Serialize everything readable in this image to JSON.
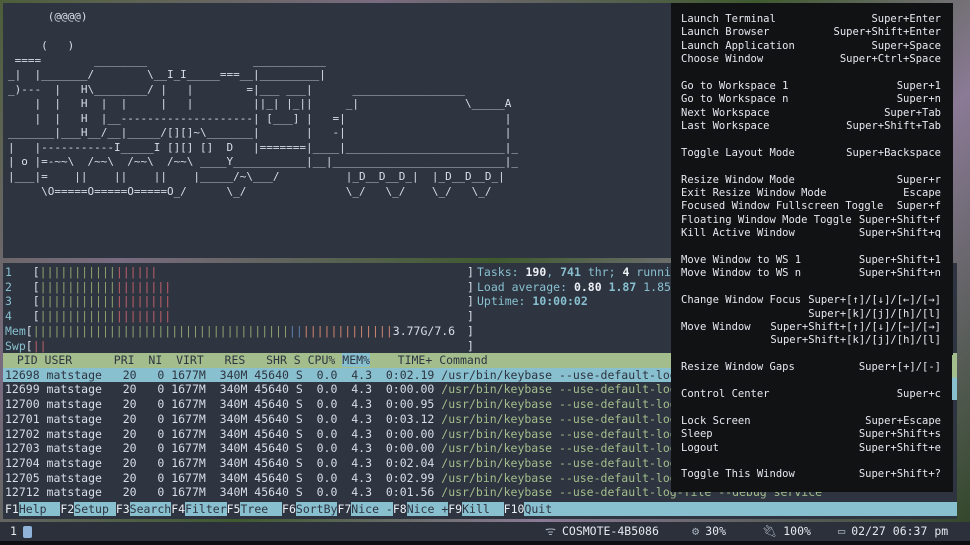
{
  "ascii_window": {
    "lines": [
      "      (@@@@)",
      "",
      "     (   )",
      " ====        ________                ___________",
      "_|  |_______/        \\__I_I_____===__|_________|",
      "_)---  |   H\\________/ |   |        =|___ ___|      _________________",
      "    |  |   H  |  |     |   |         ||_| |_||     _|                \\_____A",
      "    |  |   H  |__--------------------| [___] |   =|                        |",
      "_______|___H__/__|_____/[][]~\\_______|       |   -|                        |",
      "|   |-----------I_____I [][] []  D   |=======|____|________________________|_",
      "| o |=-~~\\  /~~\\  /~~\\  /~~\\ ____Y___________|__|__________________________|_",
      "|___|=    ||    ||    ||    |_____/~\\___/          |_D__D__D_|  |_D__D__D_|",
      "     \\O=====O=====O=====O_/      \\_/               \\_/   \\_/    \\_/   \\_/"
    ]
  },
  "htop": {
    "meters": [
      {
        "label": "1   ",
        "normal_pct": 17.7,
        "kernel_pct": 9.7
      },
      {
        "label": "2   ",
        "normal_pct": 17.7,
        "kernel_pct": 12.9
      },
      {
        "label": "3   ",
        "normal_pct": 17.7,
        "kernel_pct": 12.9
      },
      {
        "label": "4   ",
        "normal_pct": 17.7,
        "kernel_pct": 12.9
      }
    ],
    "mem": {
      "label": "Mem",
      "used_pct": 59.7,
      "buffers_pct": 3.2,
      "cache_pct": 21.0,
      "text": "3.77G/7.6"
    },
    "swp": {
      "label": "Swp",
      "used_pct": 3.2
    },
    "tasks": {
      "label": "Tasks: ",
      "count": "190",
      "sep1": ", ",
      "threads": "741",
      "thr_label": " thr; ",
      "running": "4",
      "running_label": " running"
    },
    "load": {
      "label": "Load average: ",
      "v1": "0.80",
      "v5": "1.87",
      "v15": "1.85"
    },
    "uptime": {
      "label": "Uptime: ",
      "value": "10:00:02"
    },
    "header": {
      "pre": "  PID USER      PRI  NI  VIRT   RES   SHR S CPU% ",
      "sorted": "MEM%",
      "post": "    TIME+ Command"
    },
    "processes": [
      {
        "pid": "12698",
        "user": "matstage",
        "pri": "20",
        "ni": "0",
        "virt": "1677M",
        "res": "340M",
        "shr": "45640",
        "s": "S",
        "cpu": "0.0",
        "mem": "4.3",
        "time": "0:02.19",
        "cmd": "/usr/bin/keybase --use-default-log-file --debug service"
      },
      {
        "pid": "12699",
        "user": "matstage",
        "pri": "20",
        "ni": "0",
        "virt": "1677M",
        "res": "340M",
        "shr": "45640",
        "s": "S",
        "cpu": "0.0",
        "mem": "4.3",
        "time": "0:00.00",
        "cmd": "/usr/bin/keybase --use-default-log-file --debug service"
      },
      {
        "pid": "12700",
        "user": "matstage",
        "pri": "20",
        "ni": "0",
        "virt": "1677M",
        "res": "340M",
        "shr": "45640",
        "s": "S",
        "cpu": "0.0",
        "mem": "4.3",
        "time": "0:00.95",
        "cmd": "/usr/bin/keybase --use-default-log-file --debug service"
      },
      {
        "pid": "12701",
        "user": "matstage",
        "pri": "20",
        "ni": "0",
        "virt": "1677M",
        "res": "340M",
        "shr": "45640",
        "s": "S",
        "cpu": "0.0",
        "mem": "4.3",
        "time": "0:03.12",
        "cmd": "/usr/bin/keybase --use-default-log-file --debug service"
      },
      {
        "pid": "12702",
        "user": "matstage",
        "pri": "20",
        "ni": "0",
        "virt": "1677M",
        "res": "340M",
        "shr": "45640",
        "s": "S",
        "cpu": "0.0",
        "mem": "4.3",
        "time": "0:00.00",
        "cmd": "/usr/bin/keybase --use-default-log-file --debug service"
      },
      {
        "pid": "12703",
        "user": "matstage",
        "pri": "20",
        "ni": "0",
        "virt": "1677M",
        "res": "340M",
        "shr": "45640",
        "s": "S",
        "cpu": "0.0",
        "mem": "4.3",
        "time": "0:00.00",
        "cmd": "/usr/bin/keybase --use-default-log-file --debug service"
      },
      {
        "pid": "12704",
        "user": "matstage",
        "pri": "20",
        "ni": "0",
        "virt": "1677M",
        "res": "340M",
        "shr": "45640",
        "s": "S",
        "cpu": "0.0",
        "mem": "4.3",
        "time": "0:02.04",
        "cmd": "/usr/bin/keybase --use-default-log-file --debug service"
      },
      {
        "pid": "12705",
        "user": "matstage",
        "pri": "20",
        "ni": "0",
        "virt": "1677M",
        "res": "340M",
        "shr": "45640",
        "s": "S",
        "cpu": "0.0",
        "mem": "4.3",
        "time": "0:02.99",
        "cmd": "/usr/bin/keybase --use-default-log-file --debug service"
      },
      {
        "pid": "12712",
        "user": "matstage",
        "pri": "20",
        "ni": "0",
        "virt": "1677M",
        "res": "340M",
        "shr": "45640",
        "s": "S",
        "cpu": "0.0",
        "mem": "4.3",
        "time": "0:01.56",
        "cmd": "/usr/bin/keybase --use-default-log-file --debug service"
      }
    ],
    "fkeys": [
      {
        "key": "F1",
        "label": "Help  "
      },
      {
        "key": "F2",
        "label": "Setup "
      },
      {
        "key": "F3",
        "label": "Search"
      },
      {
        "key": "F4",
        "label": "Filter"
      },
      {
        "key": "F5",
        "label": "Tree  "
      },
      {
        "key": "F6",
        "label": "SortBy"
      },
      {
        "key": "F7",
        "label": "Nice -"
      },
      {
        "key": "F8",
        "label": "Nice +"
      },
      {
        "key": "F9",
        "label": "Kill  "
      },
      {
        "key": "F10",
        "label": "Quit                                                                                          "
      }
    ]
  },
  "help": {
    "rows": [
      {
        "action": "Launch Terminal",
        "keys": "Super+Enter"
      },
      {
        "action": "Launch Browser",
        "keys": "Super+Shift+Enter"
      },
      {
        "action": "Launch Application",
        "keys": "Super+Space"
      },
      {
        "action": "Choose Window",
        "keys": "Super+Ctrl+Space"
      },
      {
        "action": "",
        "keys": ""
      },
      {
        "action": "Go to Workspace 1",
        "keys": "Super+1"
      },
      {
        "action": "Go to Workspace n",
        "keys": "Super+n"
      },
      {
        "action": "Next Workspace",
        "keys": "Super+Tab"
      },
      {
        "action": "Last Workspace",
        "keys": "Super+Shift+Tab"
      },
      {
        "action": "",
        "keys": ""
      },
      {
        "action": "Toggle Layout Mode",
        "keys": "Super+Backspace"
      },
      {
        "action": "",
        "keys": ""
      },
      {
        "action": "Resize Window Mode",
        "keys": "Super+r"
      },
      {
        "action": "Exit Resize Window Mode",
        "keys": "Escape"
      },
      {
        "action": "Focused Window Fullscreen Toggle",
        "keys": "Super+f"
      },
      {
        "action": "Floating Window Mode Toggle",
        "keys": "Super+Shift+f"
      },
      {
        "action": "Kill Active Window",
        "keys": "Super+Shift+q"
      },
      {
        "action": "",
        "keys": ""
      },
      {
        "action": "Move Window to WS 1",
        "keys": "Super+Shift+1"
      },
      {
        "action": "Move Window to WS n",
        "keys": "Super+Shift+n"
      },
      {
        "action": "",
        "keys": ""
      },
      {
        "action": "Change Window Focus",
        "keys": "Super+[↑]/[↓]/[←]/[→]"
      },
      {
        "action": "",
        "keys": "Super+[k]/[j]/[h]/[l]"
      },
      {
        "action": "Move Window",
        "keys": "Super+Shift+[↑]/[↓]/[←]/[→]"
      },
      {
        "action": "",
        "keys": "Super+Shift+[k]/[j]/[h]/[l]"
      },
      {
        "action": "",
        "keys": ""
      },
      {
        "action": "Resize Window Gaps",
        "keys": "Super+[+]/[-]"
      },
      {
        "action": "",
        "keys": ""
      },
      {
        "action": "Control Center",
        "keys": "Super+c"
      },
      {
        "action": "",
        "keys": ""
      },
      {
        "action": "Lock Screen",
        "keys": "Super+Escape"
      },
      {
        "action": "Sleep",
        "keys": "Super+Shift+s"
      },
      {
        "action": "Logout",
        "keys": "Super+Shift+e"
      },
      {
        "action": "",
        "keys": ""
      },
      {
        "action": "Toggle This Window",
        "keys": "Super+Shift+?"
      }
    ]
  },
  "statusbar": {
    "workspace": "1",
    "wifi": {
      "icon": "wifi-icon",
      "ssid": "COSMOTE-4B5086"
    },
    "cpu": {
      "icon": "gears-icon",
      "value": "30%"
    },
    "power": {
      "icon": "plug-icon",
      "value": "100%"
    },
    "clock": {
      "icon": "calendar-icon",
      "value": "02/27 06:37 pm"
    }
  }
}
